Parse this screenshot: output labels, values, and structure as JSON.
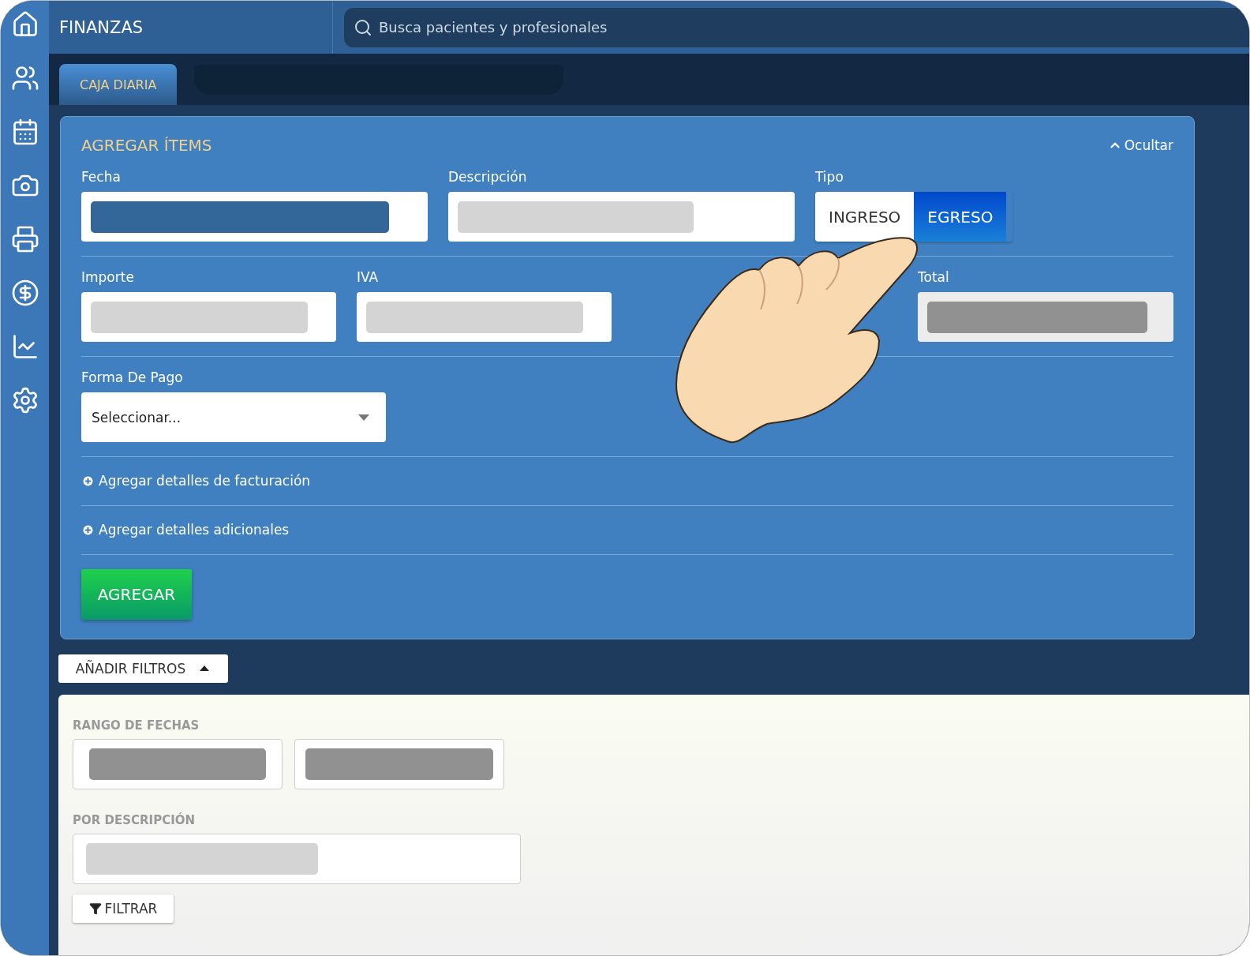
{
  "header": {
    "title": "FINANZAS",
    "search": {
      "placeholder": "Busca pacientes y profesionales"
    }
  },
  "sidebar": {
    "items": [
      {
        "kind": "home"
      },
      {
        "kind": "users"
      },
      {
        "kind": "calendar"
      },
      {
        "kind": "camera"
      },
      {
        "kind": "printer"
      },
      {
        "kind": "dollar"
      },
      {
        "kind": "chart"
      },
      {
        "kind": "settings"
      }
    ]
  },
  "tabs": [
    {
      "label": "CAJA DIARIA",
      "selected": true
    },
    {
      "kind": "blank",
      "selected": false
    }
  ],
  "add_panel": {
    "title": "AGREGAR ÍTEMS",
    "toggle": "Ocultar",
    "row_1": [
      {
        "label": "Fecha",
        "kind": "date",
        "redacted": true
      },
      {
        "label": "Descripción",
        "kind": "text",
        "redacted": true
      }
    ],
    "tipo": {
      "label": "Tipo",
      "options": [
        {
          "label": "INGRESO",
          "selected": false
        },
        {
          "label": "EGRESO",
          "selected": true
        }
      ]
    },
    "row_2": [
      {
        "label": "Importe",
        "kind": "text",
        "redacted": true
      },
      {
        "label": "IVA",
        "kind": "text",
        "redacted": true
      }
    ],
    "total": {
      "label": "Total",
      "disabled": true,
      "redacted": true
    },
    "payment": {
      "label": "Forma De Pago",
      "value": "Seleccionar..."
    },
    "expanders": [
      {
        "label": "Agregar detalles de facturación"
      },
      {
        "label": "Agregar detalles adicionales"
      }
    ],
    "submit": "AGREGAR"
  },
  "filters": {
    "button": "AÑADIR FILTROS",
    "expanded": true,
    "date_range": {
      "label": "RANGO DE FECHAS",
      "fields": [
        {
          "redacted": true
        },
        {
          "redacted": true
        }
      ]
    },
    "description": {
      "label": "POR DESCRIPCIÓN",
      "redacted": true
    },
    "submit": "FILTRAR"
  }
}
